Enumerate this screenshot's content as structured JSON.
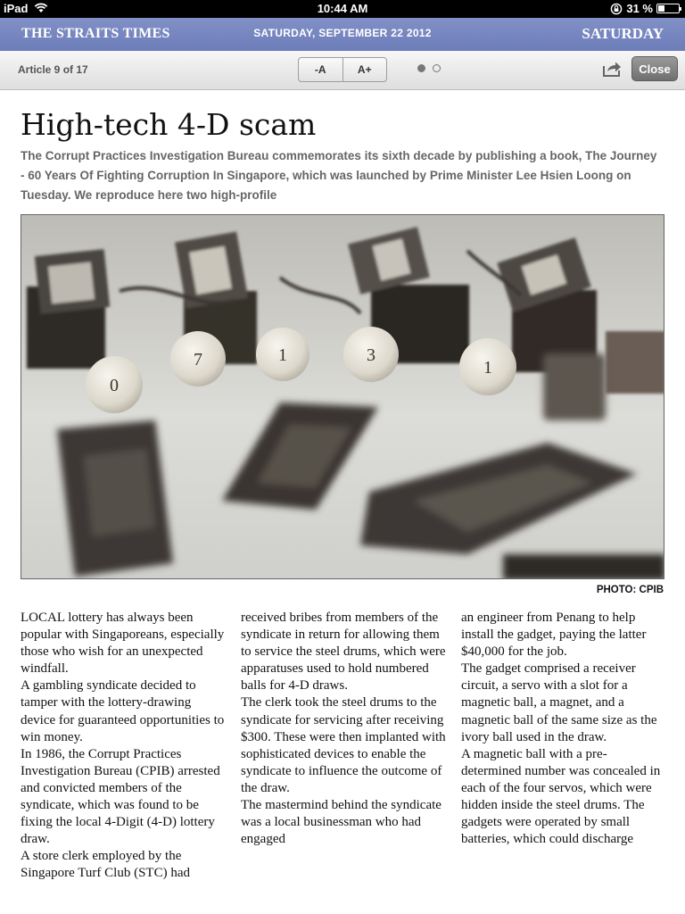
{
  "status_bar": {
    "device": "iPad",
    "time": "10:44 AM",
    "battery": "31 %",
    "battery_level": 0.31
  },
  "masthead": {
    "brand": "THE STRAITS TIMES",
    "date": "SATURDAY, SEPTEMBER 22 2012",
    "edition": "SATURDAY"
  },
  "toolbar": {
    "article_count": "Article 9 of 17",
    "font_decrease": "-A",
    "font_increase": "A+",
    "page_dots": 2,
    "active_dot": 0,
    "close_label": "Close"
  },
  "article": {
    "headline": "High-tech 4-D scam",
    "standfirst": "The Corrupt Practices Investigation Bureau commemorates its sixth decade by publishing a book, The Journey - 60 Years Of Fighting Corruption In Singapore, which was launched by Prime Minister Lee Hsien Loong on Tuesday. We reproduce here two high-profile",
    "photo_credit": "PHOTO: CPIB",
    "photo_balls": [
      "0",
      "7",
      "1",
      "3",
      "1"
    ],
    "columns": [
      [
        "LOCAL lottery has always been popular with Singaporeans, especially those who wish for an unexpected windfall.",
        " A gambling syndicate decided to tamper with the lottery-drawing device for guaranteed opportunities to win money.",
        " In 1986, the Corrupt Practices Investigation Bureau (CPIB) arrested and convicted members of the syndicate, which was found to be fixing the local 4-Digit (4-D) lottery draw.",
        " A store clerk employed by the Singapore Turf Club (STC) had"
      ],
      [
        "received bribes from members of the syndicate in return for allowing them to service the steel drums, which were apparatuses used to hold numbered balls for 4-D draws.",
        " The clerk took the steel drums to the syndicate for servicing after receiving $300. These were then implanted with sophisticated devices to enable the syndicate to influence the outcome of the draw.",
        " The mastermind behind the syndicate was a local businessman who had engaged"
      ],
      [
        "an engineer from Penang to help install the gadget, paying the latter $40,000 for the job.",
        " The gadget comprised a receiver circuit, a servo with a slot for a magnetic ball, a magnet, and a magnetic ball of the same size as the ivory ball used in the draw.",
        " A magnetic ball with a pre-determined number was concealed in each of the four servos, which were hidden inside the steel drums. The gadgets were operated by small batteries, which could discharge"
      ]
    ]
  }
}
